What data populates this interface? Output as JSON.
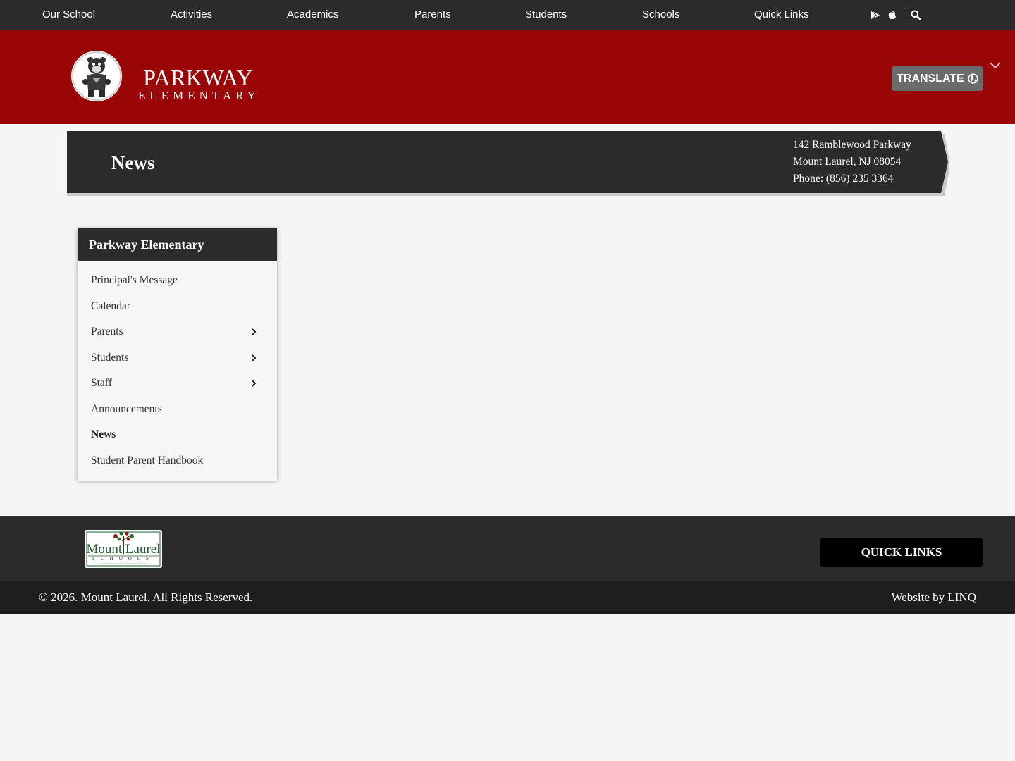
{
  "nav": {
    "items": [
      {
        "label": "Our School"
      },
      {
        "label": "Activities"
      },
      {
        "label": "Academics"
      },
      {
        "label": "Parents"
      },
      {
        "label": "Students"
      },
      {
        "label": "Schools"
      },
      {
        "label": "Quick Links"
      }
    ],
    "icons": [
      "google-play-icon",
      "apple-icon",
      "search-icon"
    ]
  },
  "header": {
    "school_name_line1": "PARKWAY",
    "school_name_line2": "ELEMENTARY",
    "translate_label": "TRANSLATE",
    "logo_icon": "panther-mascot-icon"
  },
  "banner": {
    "title": "News",
    "address_line1": "142 Ramblewood Parkway",
    "address_line2": "Mount Laurel, NJ 08054",
    "phone": "Phone: (856) 235 3364"
  },
  "sidebar": {
    "heading": "Parkway Elementary",
    "items": [
      {
        "label": "Principal's Message"
      },
      {
        "label": "Calendar"
      },
      {
        "label": "Parents"
      },
      {
        "label": "Students"
      },
      {
        "label": "Staff"
      },
      {
        "label": "Announcements"
      },
      {
        "label": "News"
      },
      {
        "label": "Student Parent Handbook"
      }
    ]
  },
  "footer": {
    "logo_line1": "Mount Laurel",
    "logo_line2": "SCHOOLS",
    "quick_links_label": "QUICK LINKS",
    "copyright": "© 2026. Mount Laurel. All Rights Reserved.",
    "credit": "Website by LINQ"
  },
  "colors": {
    "nav_bg": "#2b2b2b",
    "header_red": "#9a0606",
    "banner_bg": "#2b2b2b",
    "footer_bg": "#2b2b2b",
    "copyright_bg": "#1e1e1e",
    "page_bg": "#f5f5f5"
  }
}
